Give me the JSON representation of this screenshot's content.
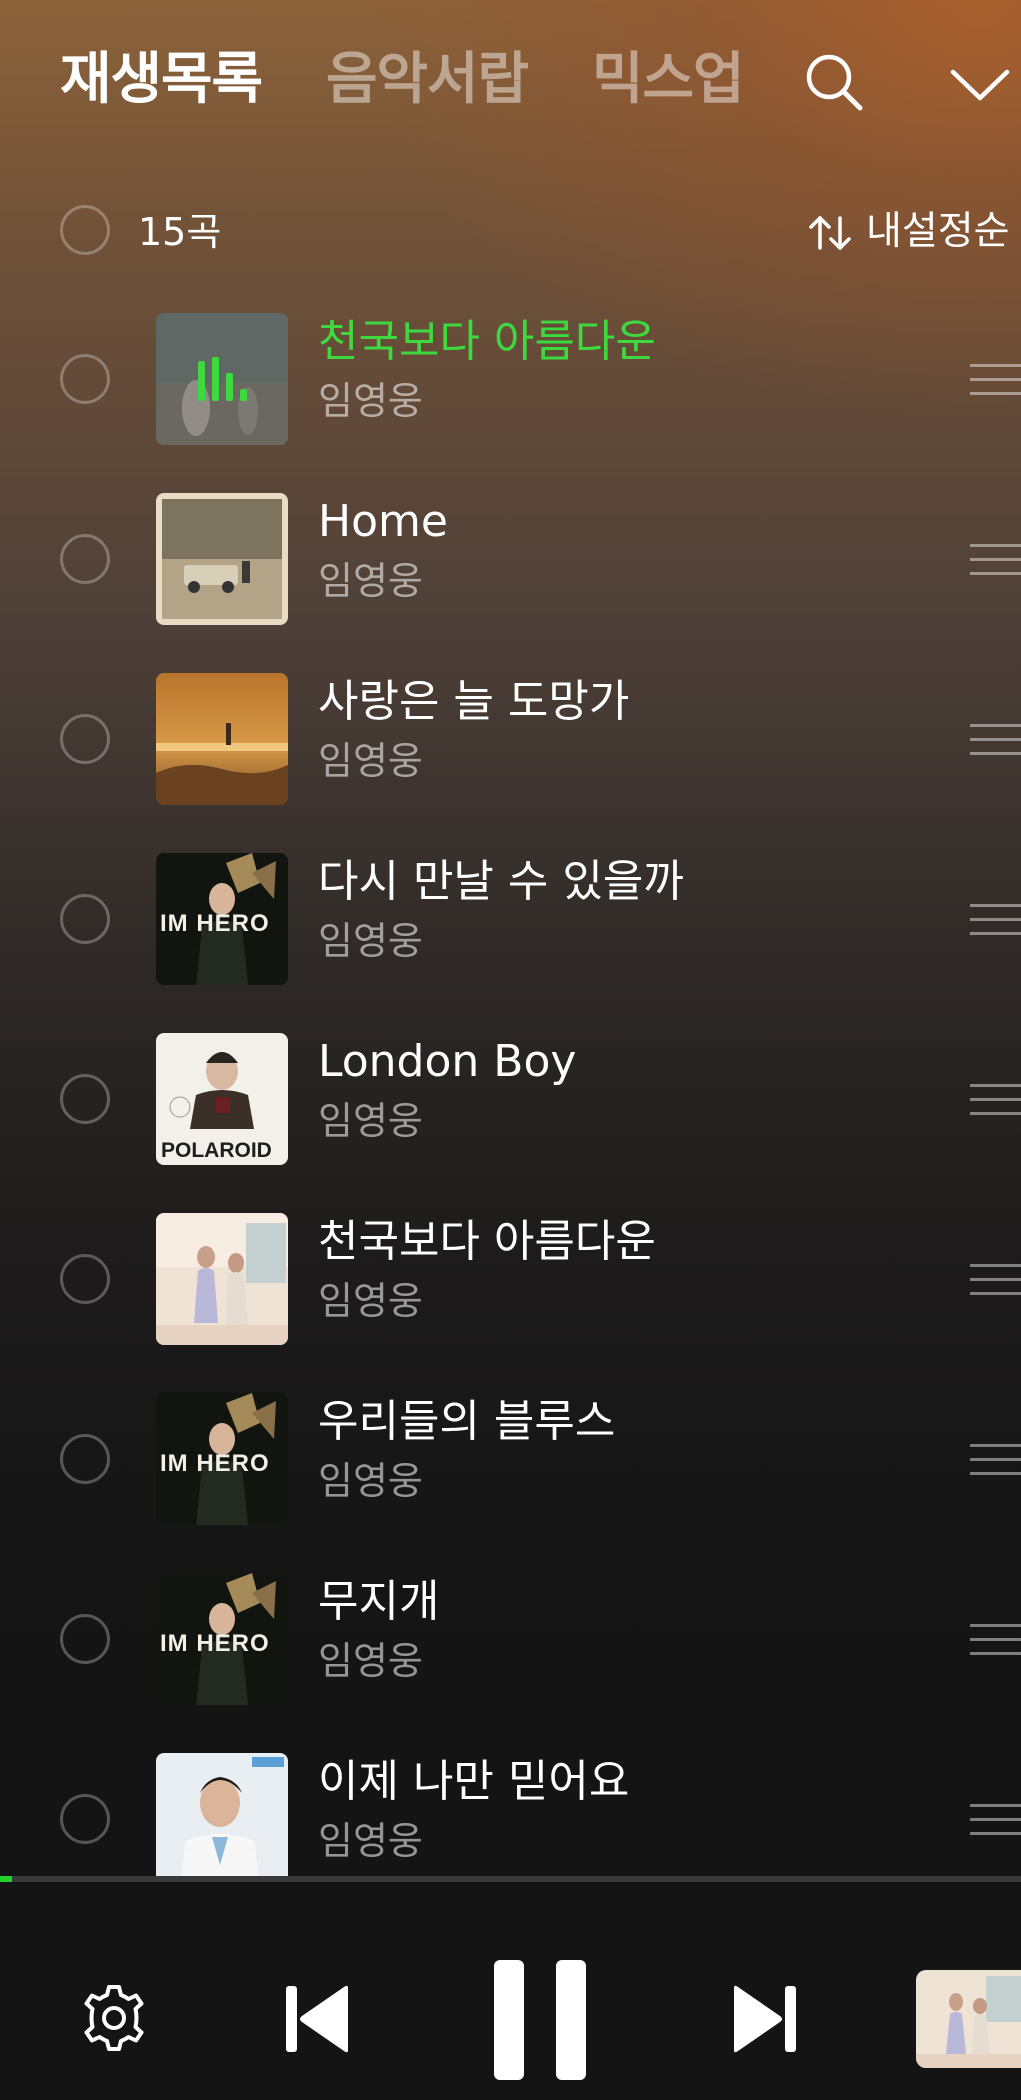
{
  "header": {
    "tabs": [
      {
        "label": "재생목록",
        "active": true
      },
      {
        "label": "음악서랍",
        "active": false
      },
      {
        "label": "믹스업",
        "active": false
      }
    ],
    "search_icon": "search-icon",
    "collapse_icon": "chevron-down-icon"
  },
  "list_header": {
    "count": "15곡",
    "sort_label": "내설정순",
    "sort_icon": "sort-arrows-icon"
  },
  "tracks": [
    {
      "title": "천국보다 아름다운",
      "artist": "임영웅",
      "playing": true
    },
    {
      "title": "Home",
      "artist": "임영웅",
      "playing": false
    },
    {
      "title": "사랑은 늘 도망가",
      "artist": "임영웅",
      "playing": false
    },
    {
      "title": "다시 만날 수 있을까",
      "artist": "임영웅",
      "playing": false,
      "art_text": "IM HERO"
    },
    {
      "title": "London Boy",
      "artist": "임영웅",
      "playing": false,
      "art_text": "POLAROID"
    },
    {
      "title": "천국보다 아름다운",
      "artist": "임영웅",
      "playing": false
    },
    {
      "title": "우리들의 블루스",
      "artist": "임영웅",
      "playing": false,
      "art_text": "IM HERO"
    },
    {
      "title": "무지개",
      "artist": "임영웅",
      "playing": false,
      "art_text": "IM HERO"
    },
    {
      "title": "이제 나만 믿어요",
      "artist": "임영웅",
      "playing": false
    }
  ],
  "player": {
    "progress": 0.012,
    "controls": [
      "settings-icon",
      "previous-icon",
      "pause-icon",
      "next-icon"
    ]
  },
  "colors": {
    "accent_green": "#3dd93f",
    "progress_green": "#22d12a",
    "background_top": "#8c623a",
    "background_bottom": "#131313"
  }
}
